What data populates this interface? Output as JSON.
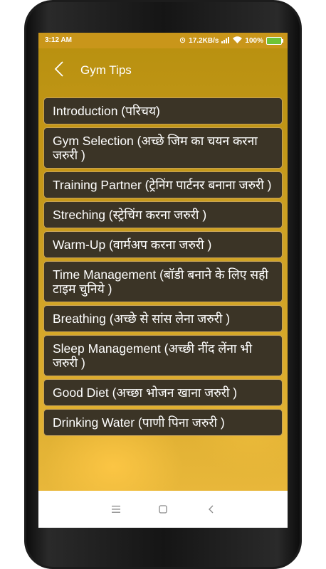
{
  "status_bar": {
    "time": "3:12 AM",
    "network_speed": "17.2KB/s",
    "battery": "100%"
  },
  "app_bar": {
    "title": "Gym Tips"
  },
  "items": [
    {
      "label": "Introduction (परिचय)"
    },
    {
      "label": "Gym Selection  (अच्छे जिम का चयन करना जरुरी )"
    },
    {
      "label": "Training Partner  (ट्रेनिंग पार्टनर बनाना जरुरी )"
    },
    {
      "label": "Streching  (स्ट्रेचिंग करना जरुरी )"
    },
    {
      "label": "Warm-Up  (वार्मअप करना जरुरी )"
    },
    {
      "label": "Time Management  (बॉडी बनाने के लिए सही टाइम चुनिये )"
    },
    {
      "label": "Breathing (अच्छे से सांस लेना जरुरी )"
    },
    {
      "label": "Sleep Management (अच्छी नींद लेंना भी जरुरी )"
    },
    {
      "label": "Good Diet (अच्छा भोजन खाना जरुरी )"
    },
    {
      "label": "Drinking Water  (पाणी पिना जरुरी )"
    }
  ],
  "icons": {
    "back": "back-arrow-icon",
    "wifi": "wifi-icon",
    "signal": "signal-icon",
    "battery": "battery-icon",
    "menu": "menu-icon",
    "home": "home-icon",
    "nav_back": "nav-back-icon"
  },
  "colors": {
    "status_bar": "#c9961a",
    "item_background": "#3b3426",
    "item_border": "#c9a45a",
    "text": "#ffffff"
  }
}
